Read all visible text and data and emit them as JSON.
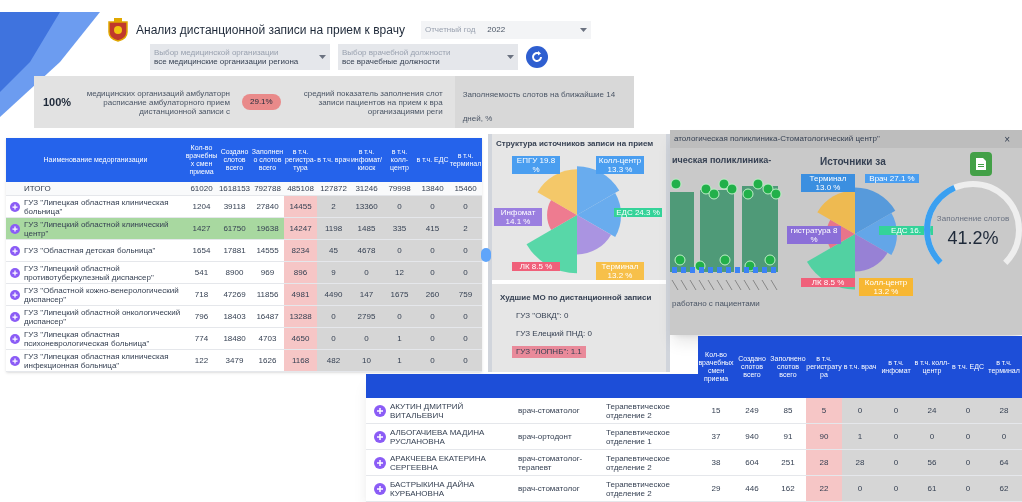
{
  "header": {
    "title": "Анализ дистанционной записи на прием к врачу",
    "year_field": {
      "label": "Отчетный год",
      "value": "2022"
    },
    "filters": [
      {
        "label": "Выбор медицинской организации",
        "value": "все медицинские организации региона"
      },
      {
        "label": "Выбор врачебной должности",
        "value": "все врачебные должности"
      }
    ]
  },
  "kpis": {
    "share": "100%",
    "share_text": "медицинских организаций амбулаторн расписание амбулаторного прием дистанционной записи с",
    "badge": "29.1%",
    "avg_text": "средний показатель заполнения слот записи пациентов на прием к вра организациями реги",
    "forecast_text": "Заполняемость слотов на ближайшие 14 дней, %"
  },
  "org_table": {
    "columns": [
      "Наименование медорганизации",
      "Кол-во врачебных смен приема",
      "Создано слотов всего",
      "Заполнено слотов всего",
      "в т.ч. регистра-тура",
      "в т.ч. врач",
      "в т.ч. инфомат/ киоск",
      "в т.ч. колл-центр",
      "в т.ч. ЕДС",
      "в т.ч. терминал"
    ],
    "rows": [
      {
        "kind": "total",
        "selected": false,
        "cells": [
          "ИТОГО",
          "61020",
          "1618153",
          "792788",
          "485108",
          "127872",
          "31246",
          "79998",
          "13840",
          "15460"
        ]
      },
      {
        "kind": "org",
        "selected": false,
        "cells": [
          "ГУЗ \"Липецкая областная клиническая больница\"",
          "1204",
          "39118",
          "27840",
          "14455",
          "2",
          "13360",
          "0",
          "0",
          "0"
        ]
      },
      {
        "kind": "org",
        "selected": true,
        "cells": [
          "ГУЗ \"Липецкий областной клинический центр\"",
          "1427",
          "61750",
          "19638",
          "14247",
          "1198",
          "1485",
          "335",
          "415",
          "2"
        ]
      },
      {
        "kind": "org",
        "selected": false,
        "cells": [
          "ГУЗ \"Областная детская больница\"",
          "1654",
          "17881",
          "14555",
          "8234",
          "45",
          "4678",
          "0",
          "0",
          "0"
        ]
      },
      {
        "kind": "org",
        "selected": false,
        "cells": [
          "ГУЗ \"Липецкий областной противотуберкулезный диспансер\"",
          "541",
          "8900",
          "969",
          "896",
          "9",
          "0",
          "12",
          "0",
          "0"
        ]
      },
      {
        "kind": "org",
        "selected": false,
        "cells": [
          "ГУЗ \"Областной кожно-венерологический диспансер\"",
          "718",
          "47269",
          "11856",
          "4981",
          "4490",
          "147",
          "1675",
          "260",
          "759"
        ]
      },
      {
        "kind": "org",
        "selected": false,
        "cells": [
          "ГУЗ \"Липецкий областной онкологический диспансер\"",
          "796",
          "18403",
          "16487",
          "13288",
          "0",
          "2795",
          "0",
          "0",
          "0"
        ]
      },
      {
        "kind": "org",
        "selected": false,
        "cells": [
          "ГУЗ \"Липецкая областная психоневрологическая больница\"",
          "774",
          "18480",
          "4703",
          "4650",
          "0",
          "0",
          "1",
          "0",
          "0"
        ]
      },
      {
        "kind": "org",
        "selected": false,
        "cells": [
          "ГУЗ \"Липецкая областная клиническая инфекционная больница\"",
          "122",
          "3479",
          "1626",
          "1168",
          "482",
          "10",
          "1",
          "0",
          "0"
        ]
      }
    ]
  },
  "sources_chart": {
    "title": "Структура источников записи на прием",
    "labels": [
      {
        "text": "ЕПГУ 19.8 %",
        "color": "#4a9ef0"
      },
      {
        "text": "Колл-центр 13.3 %",
        "color": "#4a9ef0"
      },
      {
        "text": "Инфомат 14.1 %",
        "color": "#9b7fe0"
      },
      {
        "text": "ЕДС 24.3 %",
        "color": "#34d399"
      },
      {
        "text": "ЛК 8.5 %",
        "color": "#f0607a"
      },
      {
        "text": "Терминал 13.2 %",
        "color": "#f7c04a"
      }
    ]
  },
  "worst": {
    "title": "Худшие МО по дистанционной записи",
    "items": [
      {
        "text": "ГУЗ \"ОВКД\": 0",
        "highlighted": false
      },
      {
        "text": "ГУЗ Елецкий ПНД: 0",
        "highlighted": false
      },
      {
        "text": "ГУЗ \"ЛОПНБ\": 1.1",
        "highlighted": true
      }
    ]
  },
  "popup": {
    "title": "атологическая поликлиника-Стоматологический центр\"",
    "close": "×",
    "chart_title": "ическая поликлиника-",
    "sources_title": "Источники за",
    "caption": "работано с пациентами",
    "labels": [
      {
        "text": "Терминал 13.0 %",
        "color": "#3b8fe0"
      },
      {
        "text": "Врач 27.1 %",
        "color": "#4a9ef0"
      },
      {
        "text": "гистратура 8 %",
        "color": "#8b6fd8"
      },
      {
        "text": "ЕДС 16.",
        "color": "#34d399"
      },
      {
        "text": "ЛК 8.5 %",
        "color": "#f0607a"
      },
      {
        "text": "Колл-центр 13.2 %",
        "color": "#f7b733"
      }
    ],
    "gauge": {
      "label": "Заполнение слотов",
      "value": "41.2%",
      "level": 0.412
    }
  },
  "doctor_table": {
    "columns": [
      "Кол-во врачебных смен приема",
      "Создано слотов всего",
      "Заполнено слотов всего",
      "в т.ч. регистратура",
      "в т.ч. врач",
      "в т.ч. инфомат",
      "в т.ч. колл-центр",
      "в т.ч. ЕДС",
      "в т.ч. терминал"
    ],
    "rows": [
      {
        "name": "АКУТИН ДМИТРИЙ ВИТАЛЬЕВИЧ",
        "position": "врач-стоматолог",
        "department": "Терапевтическое отделение 2",
        "values": [
          "15",
          "249",
          "85",
          "5",
          "0",
          "0",
          "24",
          "0",
          "28"
        ]
      },
      {
        "name": "АЛБОГАЧИЕВА МАДИНА РУСЛАНОВНА",
        "position": "врач-ортодонт",
        "department": "Терапевтическое отделение 1",
        "values": [
          "37",
          "940",
          "91",
          "90",
          "1",
          "0",
          "0",
          "0",
          "0"
        ]
      },
      {
        "name": "АРАКЧЕЕВА ЕКАТЕРИНА СЕРГЕЕВНА",
        "position": "врач-стоматолог-терапевт",
        "department": "Терапевтическое отделение 2",
        "values": [
          "38",
          "604",
          "251",
          "28",
          "28",
          "0",
          "56",
          "0",
          "64"
        ]
      },
      {
        "name": "БАСТРЫКИНА ДАЙНА КУРБАНОВНА",
        "position": "врач-стоматолог",
        "department": "Терапевтическое отделение 2",
        "values": [
          "29",
          "446",
          "162",
          "22",
          "0",
          "0",
          "61",
          "0",
          "62"
        ]
      }
    ]
  }
}
